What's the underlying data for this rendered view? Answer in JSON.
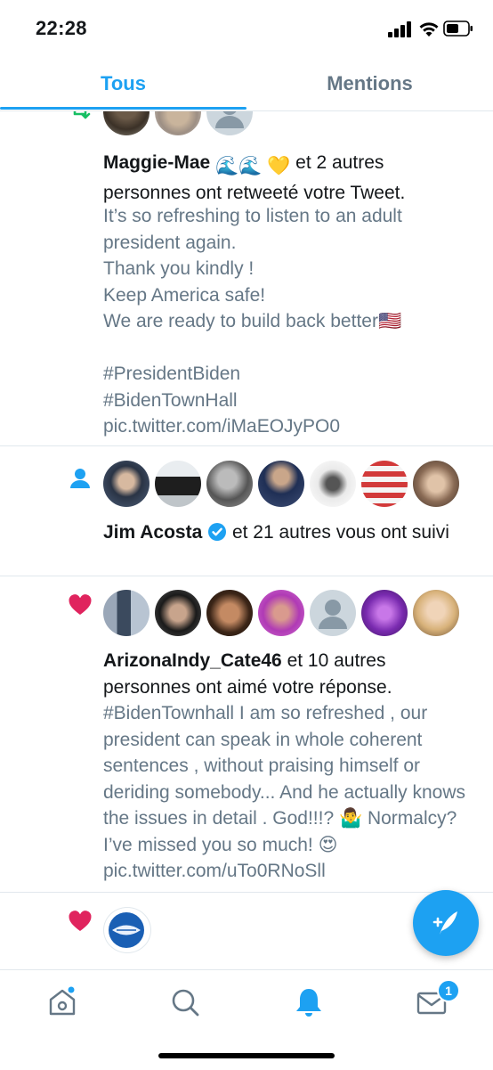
{
  "status_bar": {
    "time": "22:28"
  },
  "tabs": [
    {
      "label": "Tous",
      "active": true
    },
    {
      "label": "Mentions",
      "active": false
    }
  ],
  "colors": {
    "accent": "#1da1f2",
    "like": "#e0245e",
    "secondary_text": "#657786",
    "retweet": "#17bf63"
  },
  "notifications": [
    {
      "type": "retweet",
      "icon": "retweet-icon",
      "user": "Maggie-Mae",
      "user_emoji": "🌊🌊 💛",
      "action": "et 2 autres personnes ont retweeté votre Tweet.",
      "text": "It’s so refreshing to listen to an adult president again.\nThank you kindly !\nKeep America safe!\nWe are ready to build back better🇺🇸\n\n#PresidentBiden\n#BidenTownHall pic.twitter.com/iMaEOJyPO0"
    },
    {
      "type": "follow",
      "icon": "person-icon",
      "user": "Jim Acosta",
      "verified": true,
      "action": "et 21 autres vous ont suivi"
    },
    {
      "type": "like",
      "icon": "heart-icon",
      "user": "ArizonaIndy_Cate46",
      "action": "et 10 autres personnes ont aimé votre réponse.",
      "text": "#BidenTownhall I am so refreshed , our president can speak in whole coherent sentences , without praising himself or deriding somebody... And he actually knows the issues in detail . God!!!? 🤷‍♂️ Normalcy? I’ve missed you so much! 😍 pic.twitter.com/uTo0RNoSll"
    },
    {
      "type": "like",
      "icon": "heart-icon"
    }
  ],
  "bottom_nav": {
    "items": [
      "home-icon",
      "search-icon",
      "notifications-icon",
      "messages-icon"
    ],
    "messages_badge": "1"
  }
}
